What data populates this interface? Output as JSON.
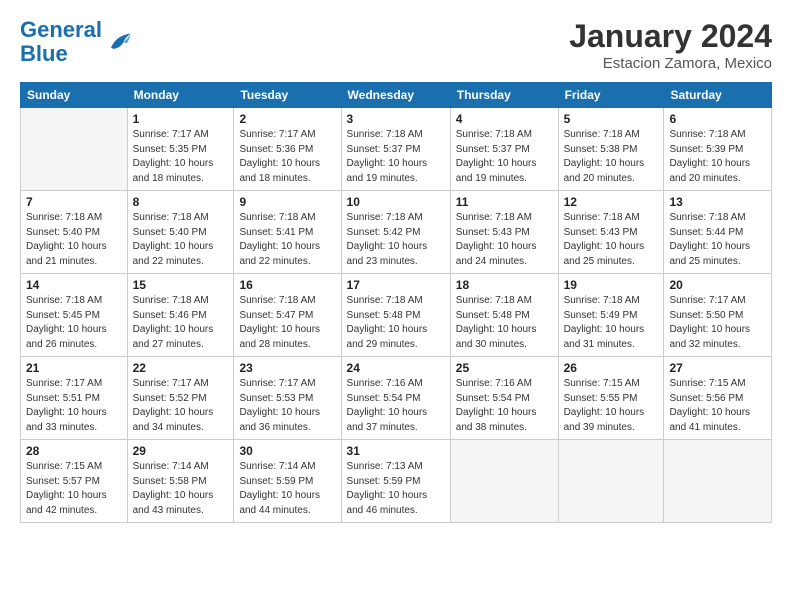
{
  "header": {
    "logo_line1": "General",
    "logo_line2": "Blue",
    "main_title": "January 2024",
    "subtitle": "Estacion Zamora, Mexico"
  },
  "calendar": {
    "days_of_week": [
      "Sunday",
      "Monday",
      "Tuesday",
      "Wednesday",
      "Thursday",
      "Friday",
      "Saturday"
    ],
    "weeks": [
      [
        {
          "day": "",
          "empty": true
        },
        {
          "day": "1",
          "sunrise": "7:17 AM",
          "sunset": "5:35 PM",
          "daylight": "10 hours and 18 minutes."
        },
        {
          "day": "2",
          "sunrise": "7:17 AM",
          "sunset": "5:36 PM",
          "daylight": "10 hours and 18 minutes."
        },
        {
          "day": "3",
          "sunrise": "7:18 AM",
          "sunset": "5:37 PM",
          "daylight": "10 hours and 19 minutes."
        },
        {
          "day": "4",
          "sunrise": "7:18 AM",
          "sunset": "5:37 PM",
          "daylight": "10 hours and 19 minutes."
        },
        {
          "day": "5",
          "sunrise": "7:18 AM",
          "sunset": "5:38 PM",
          "daylight": "10 hours and 20 minutes."
        },
        {
          "day": "6",
          "sunrise": "7:18 AM",
          "sunset": "5:39 PM",
          "daylight": "10 hours and 20 minutes."
        }
      ],
      [
        {
          "day": "7",
          "sunrise": "7:18 AM",
          "sunset": "5:40 PM",
          "daylight": "10 hours and 21 minutes."
        },
        {
          "day": "8",
          "sunrise": "7:18 AM",
          "sunset": "5:40 PM",
          "daylight": "10 hours and 22 minutes."
        },
        {
          "day": "9",
          "sunrise": "7:18 AM",
          "sunset": "5:41 PM",
          "daylight": "10 hours and 22 minutes."
        },
        {
          "day": "10",
          "sunrise": "7:18 AM",
          "sunset": "5:42 PM",
          "daylight": "10 hours and 23 minutes."
        },
        {
          "day": "11",
          "sunrise": "7:18 AM",
          "sunset": "5:43 PM",
          "daylight": "10 hours and 24 minutes."
        },
        {
          "day": "12",
          "sunrise": "7:18 AM",
          "sunset": "5:43 PM",
          "daylight": "10 hours and 25 minutes."
        },
        {
          "day": "13",
          "sunrise": "7:18 AM",
          "sunset": "5:44 PM",
          "daylight": "10 hours and 25 minutes."
        }
      ],
      [
        {
          "day": "14",
          "sunrise": "7:18 AM",
          "sunset": "5:45 PM",
          "daylight": "10 hours and 26 minutes."
        },
        {
          "day": "15",
          "sunrise": "7:18 AM",
          "sunset": "5:46 PM",
          "daylight": "10 hours and 27 minutes."
        },
        {
          "day": "16",
          "sunrise": "7:18 AM",
          "sunset": "5:47 PM",
          "daylight": "10 hours and 28 minutes."
        },
        {
          "day": "17",
          "sunrise": "7:18 AM",
          "sunset": "5:48 PM",
          "daylight": "10 hours and 29 minutes."
        },
        {
          "day": "18",
          "sunrise": "7:18 AM",
          "sunset": "5:48 PM",
          "daylight": "10 hours and 30 minutes."
        },
        {
          "day": "19",
          "sunrise": "7:18 AM",
          "sunset": "5:49 PM",
          "daylight": "10 hours and 31 minutes."
        },
        {
          "day": "20",
          "sunrise": "7:17 AM",
          "sunset": "5:50 PM",
          "daylight": "10 hours and 32 minutes."
        }
      ],
      [
        {
          "day": "21",
          "sunrise": "7:17 AM",
          "sunset": "5:51 PM",
          "daylight": "10 hours and 33 minutes."
        },
        {
          "day": "22",
          "sunrise": "7:17 AM",
          "sunset": "5:52 PM",
          "daylight": "10 hours and 34 minutes."
        },
        {
          "day": "23",
          "sunrise": "7:17 AM",
          "sunset": "5:53 PM",
          "daylight": "10 hours and 36 minutes."
        },
        {
          "day": "24",
          "sunrise": "7:16 AM",
          "sunset": "5:54 PM",
          "daylight": "10 hours and 37 minutes."
        },
        {
          "day": "25",
          "sunrise": "7:16 AM",
          "sunset": "5:54 PM",
          "daylight": "10 hours and 38 minutes."
        },
        {
          "day": "26",
          "sunrise": "7:15 AM",
          "sunset": "5:55 PM",
          "daylight": "10 hours and 39 minutes."
        },
        {
          "day": "27",
          "sunrise": "7:15 AM",
          "sunset": "5:56 PM",
          "daylight": "10 hours and 41 minutes."
        }
      ],
      [
        {
          "day": "28",
          "sunrise": "7:15 AM",
          "sunset": "5:57 PM",
          "daylight": "10 hours and 42 minutes."
        },
        {
          "day": "29",
          "sunrise": "7:14 AM",
          "sunset": "5:58 PM",
          "daylight": "10 hours and 43 minutes."
        },
        {
          "day": "30",
          "sunrise": "7:14 AM",
          "sunset": "5:59 PM",
          "daylight": "10 hours and 44 minutes."
        },
        {
          "day": "31",
          "sunrise": "7:13 AM",
          "sunset": "5:59 PM",
          "daylight": "10 hours and 46 minutes."
        },
        {
          "day": "",
          "empty": true
        },
        {
          "day": "",
          "empty": true
        },
        {
          "day": "",
          "empty": true
        }
      ]
    ]
  }
}
